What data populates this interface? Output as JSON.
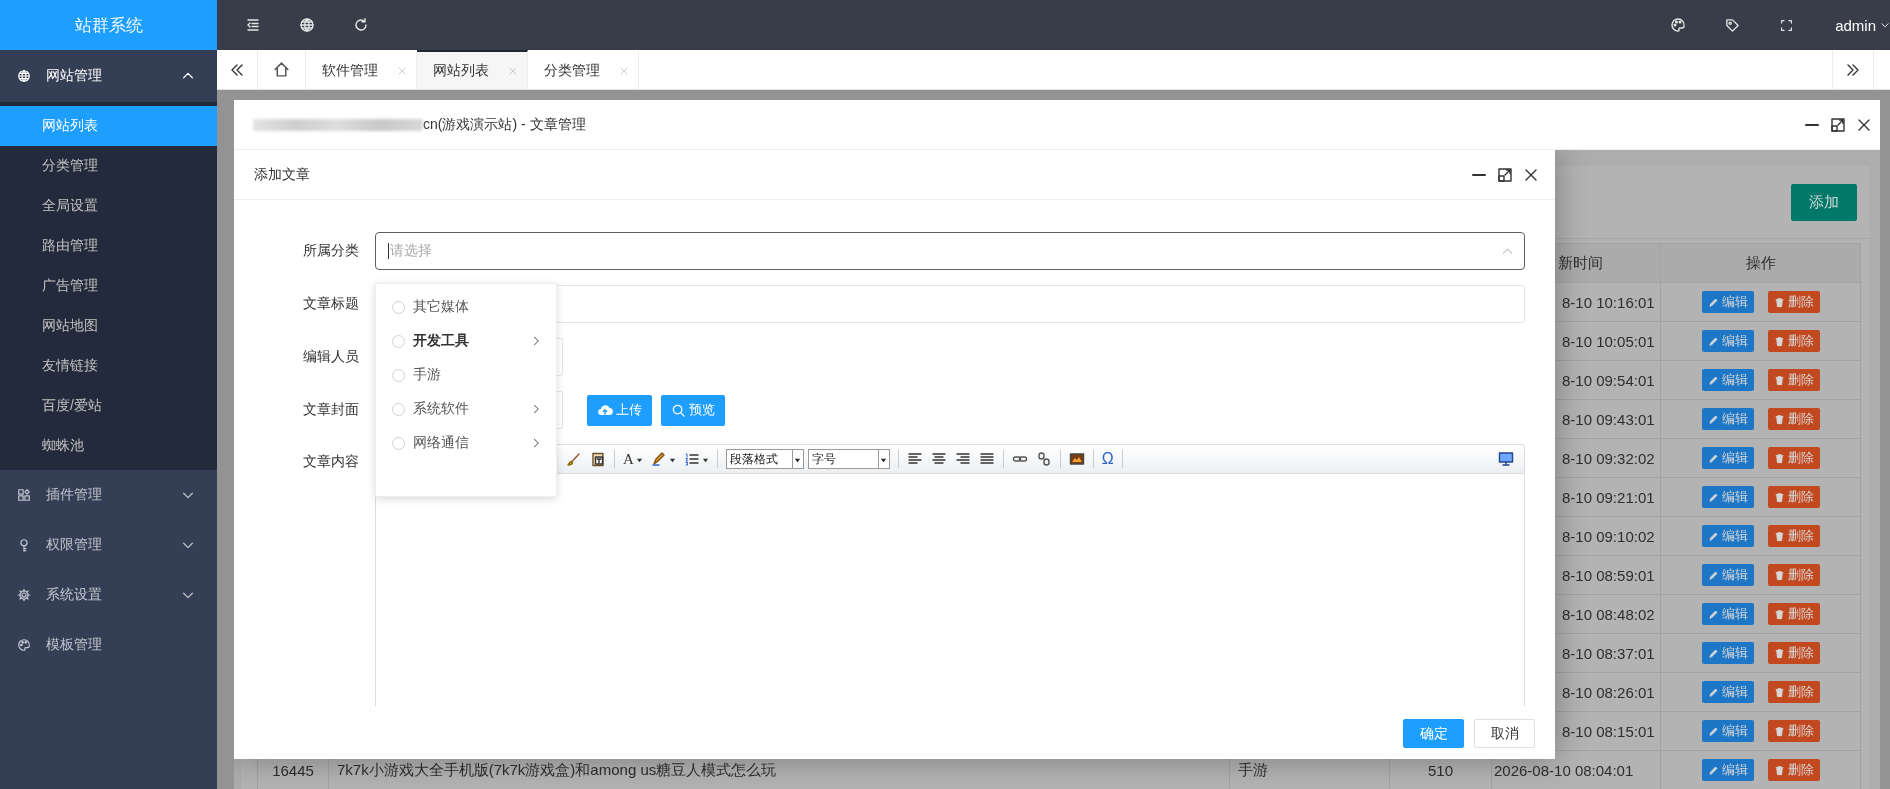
{
  "top_bar": {
    "logo": "站群系统",
    "user": "admin"
  },
  "sidebar": {
    "groups": [
      {
        "label": "网站管理",
        "kind": "folder",
        "expanded": true,
        "children": [
          {
            "label": "网站列表",
            "selected": true
          },
          {
            "label": "分类管理",
            "selected": false
          },
          {
            "label": "全局设置",
            "selected": false
          },
          {
            "label": "路由管理",
            "selected": false
          },
          {
            "label": "广告管理",
            "selected": false
          },
          {
            "label": "网站地图",
            "selected": false
          },
          {
            "label": "友情链接",
            "selected": false
          },
          {
            "label": "百度/爱站",
            "selected": false
          },
          {
            "label": "蜘蛛池",
            "selected": false
          }
        ]
      },
      {
        "label": "插件管理",
        "kind": "folder",
        "expanded": false
      },
      {
        "label": "权限管理",
        "kind": "folder",
        "expanded": false
      },
      {
        "label": "系统设置",
        "kind": "folder",
        "expanded": false
      },
      {
        "label": "模板管理",
        "kind": "link"
      }
    ]
  },
  "tabs": [
    {
      "label": "软件管理",
      "selected": false
    },
    {
      "label": "网站列表",
      "selected": true
    },
    {
      "label": "分类管理",
      "selected": false
    }
  ],
  "outer_window": {
    "title": "cn(游戏演示站) - 文章管理"
  },
  "list_page": {
    "add_button": "添加",
    "table": {
      "header": {
        "time": "新时间",
        "actions": "操作"
      },
      "rows": [
        {
          "time": "8-10 10:16:01",
          "actions": [
            "编辑",
            "删除"
          ]
        },
        {
          "time": "8-10 10:05:01",
          "actions": [
            "编辑",
            "删除"
          ]
        },
        {
          "time": "8-10 09:54:01",
          "actions": [
            "编辑",
            "删除"
          ]
        },
        {
          "time": "8-10 09:43:01",
          "actions": [
            "编辑",
            "删除"
          ]
        },
        {
          "time": "8-10 09:32:02",
          "actions": [
            "编辑",
            "删除"
          ]
        },
        {
          "time": "8-10 09:21:01",
          "actions": [
            "编辑",
            "删除"
          ]
        },
        {
          "time": "8-10 09:10:02",
          "actions": [
            "编辑",
            "删除"
          ]
        },
        {
          "time": "8-10 08:59:01",
          "actions": [
            "编辑",
            "删除"
          ]
        },
        {
          "time": "8-10 08:48:02",
          "actions": [
            "编辑",
            "删除"
          ]
        },
        {
          "time": "8-10 08:37:01",
          "actions": [
            "编辑",
            "删除"
          ]
        },
        {
          "time": "8-10 08:26:01",
          "actions": [
            "编辑",
            "删除"
          ]
        },
        {
          "time": "8-10 08:15:01",
          "actions": [
            "编辑",
            "删除"
          ]
        },
        {
          "id": "16445",
          "title": "7k7k小游戏大全手机版(7k7k游戏盒)和among us糖豆人模式怎么玩",
          "category": "手游",
          "count": "510",
          "time": "2026-08-10 08:04:01",
          "actions": [
            "编辑",
            "删除"
          ]
        }
      ]
    }
  },
  "dialog": {
    "title": "添加文章",
    "fields": [
      {
        "kind": "select",
        "label": "所属分类",
        "placeholder": "请选择",
        "focused": true
      },
      {
        "kind": "text",
        "label": "文章标题"
      },
      {
        "kind": "short",
        "label": "编辑人员"
      },
      {
        "kind": "upload",
        "label": "文章封面",
        "buttons": [
          "上传",
          "预览"
        ]
      },
      {
        "kind": "editor",
        "label": "文章内容",
        "font_color_button": "A",
        "selects": [
          "段落格式",
          "字号"
        ],
        "special_char_button": "Ω"
      }
    ],
    "dropdown": [
      {
        "label": "其它媒体",
        "has_children": false,
        "highlighted": false
      },
      {
        "label": "开发工具",
        "has_children": true,
        "highlighted": true
      },
      {
        "label": "手游",
        "has_children": false,
        "highlighted": false
      },
      {
        "label": "系统软件",
        "has_children": true,
        "highlighted": false
      },
      {
        "label": "网络通信",
        "has_children": true,
        "highlighted": false
      }
    ],
    "buttons": [
      {
        "label": "确定",
        "kind": "primary"
      },
      {
        "label": "取消",
        "kind": "default"
      }
    ]
  }
}
